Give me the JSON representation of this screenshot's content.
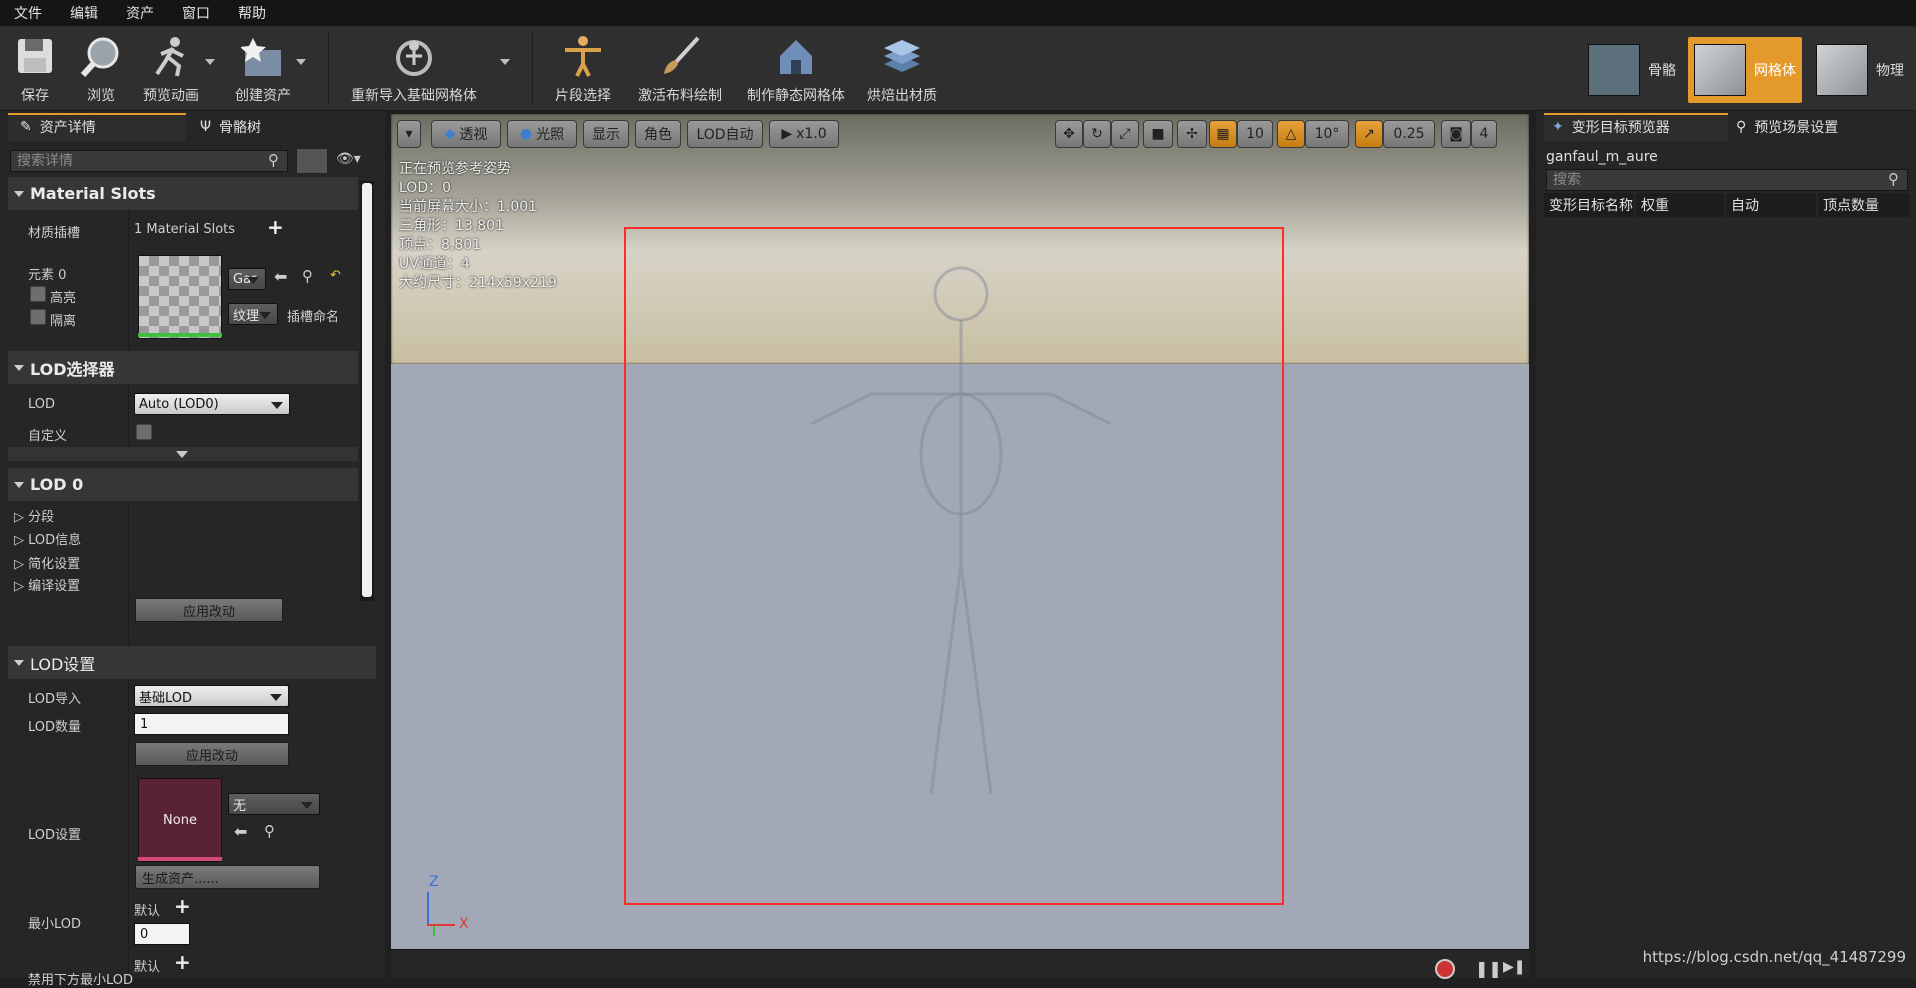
{
  "menu": [
    "文件",
    "编辑",
    "资产",
    "窗口",
    "帮助"
  ],
  "toolbar": {
    "save": "保存",
    "browse": "浏览",
    "preview_anim": "预览动画",
    "create_asset": "创建资产",
    "reimport": "重新导入基础网格体",
    "section_select": "片段选择",
    "cloth_paint": "激活布料绘制",
    "make_static": "制作静态网格体",
    "bake_material": "烘焙出材质"
  },
  "modes": {
    "skeleton": "骨骼",
    "mesh": "网格体",
    "physics": "物理"
  },
  "left_panel": {
    "tab_details": "资产详情",
    "tab_skeleton_tree": "骨骼树",
    "search_placeholder": "搜索详情",
    "material_slots_header": "Material Slots",
    "material_slot_label": "材质插槽",
    "material_slot_count": "1 Material Slots",
    "element0": "元素 0",
    "highlight": "高亮",
    "isolate": "隔离",
    "mat_combo": "Gar",
    "texture_combo": "纹理",
    "slot_name": "插槽命名",
    "lod_picker_header": "LOD选择器",
    "lod_label": "LOD",
    "lod_value": "Auto (LOD0)",
    "custom_label": "自定义",
    "lod0_header": "LOD 0",
    "sections": "分段",
    "lod_info": "LOD信息",
    "reduction": "简化设置",
    "build_settings": "编译设置",
    "apply_changes": "应用改动",
    "lod_settings_header": "LOD设置",
    "lod_import": "LOD导入",
    "lod_import_value": "基础LOD",
    "lod_count": "LOD数量",
    "lod_count_value": "1",
    "apply_changes2": "应用改动",
    "lod_settings_label": "LOD设置",
    "none_thumb": "None",
    "none_combo": "无",
    "generate_asset": "生成资产......",
    "min_lod": "最小LOD",
    "default1": "默认",
    "min_lod_value": "0",
    "disable_below": "禁用下方最小LOD",
    "default2": "默认"
  },
  "viewport": {
    "perspective": "透视",
    "lighting": "光照",
    "show": "显示",
    "character": "角色",
    "lod_auto": "LOD自动",
    "speed": "x1.0",
    "grid_snap": "10",
    "rot_snap": "10°",
    "scale_snap": "0.25",
    "cam_speed": "4",
    "stats": [
      "正在预览参考姿势",
      "LOD：0",
      "当前屏幕大小：1.001",
      "三角形：13,801",
      "顶点：8,801",
      "UV通道：4",
      "大约尺寸：214x59x219"
    ],
    "axis_z": "Z",
    "axis_x": "X"
  },
  "right_panel": {
    "tab_morph": "变形目标预览器",
    "tab_scene": "预览场景设置",
    "asset_name": "ganfaul_m_aure",
    "search_placeholder": "搜索",
    "columns": [
      "变形目标名称",
      "权重",
      "自动",
      "顶点数量"
    ]
  },
  "watermark": "https://blog.csdn.net/qq_41487299",
  "colors": {
    "accent_orange": "#e4a23a",
    "highlight_red": "#ff2a2a",
    "panel": "#262626"
  }
}
